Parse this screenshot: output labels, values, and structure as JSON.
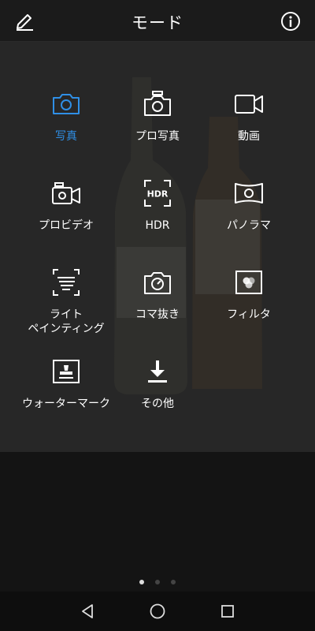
{
  "header": {
    "title": "モード"
  },
  "modes": [
    {
      "label": "写真",
      "icon": "camera-icon"
    },
    {
      "label": "プロ写真",
      "icon": "pro-camera-icon"
    },
    {
      "label": "動画",
      "icon": "video-camera-icon"
    },
    {
      "label": "プロビデオ",
      "icon": "pro-video-icon"
    },
    {
      "label": "HDR",
      "icon": "hdr-icon"
    },
    {
      "label": "パノラマ",
      "icon": "panorama-icon"
    },
    {
      "label": "ライト\nペインティング",
      "icon": "light-painting-icon"
    },
    {
      "label": "コマ抜き",
      "icon": "time-lapse-icon"
    },
    {
      "label": "フィルタ",
      "icon": "filter-icon"
    },
    {
      "label": "ウォーターマーク",
      "icon": "watermark-icon"
    },
    {
      "label": "その他",
      "icon": "download-icon"
    }
  ],
  "active_mode": "写真",
  "colors": {
    "accent": "#2f8fe6",
    "background": "#141414",
    "text": "#ffffff"
  },
  "pager": {
    "pages": 3,
    "current": 1
  },
  "hdr_icon_text": "HDR"
}
